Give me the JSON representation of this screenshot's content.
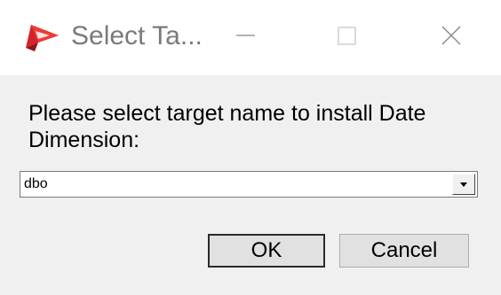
{
  "window": {
    "title": "Select Ta...",
    "icon": "app-logo-icon",
    "controls": {
      "minimize": "minimize-icon",
      "maximize": "maximize-icon",
      "close": "close-icon"
    }
  },
  "dialog": {
    "prompt": "Please select target name to install Date Dimension:",
    "target_select": {
      "value": "dbo"
    },
    "buttons": {
      "ok_label": "OK",
      "cancel_label": "Cancel"
    }
  },
  "colors": {
    "titlebar_bg": "#ffffff",
    "dialog_bg": "#f0f0f0",
    "icon_red": "#d2232a",
    "title_text": "#7a7a7a"
  }
}
